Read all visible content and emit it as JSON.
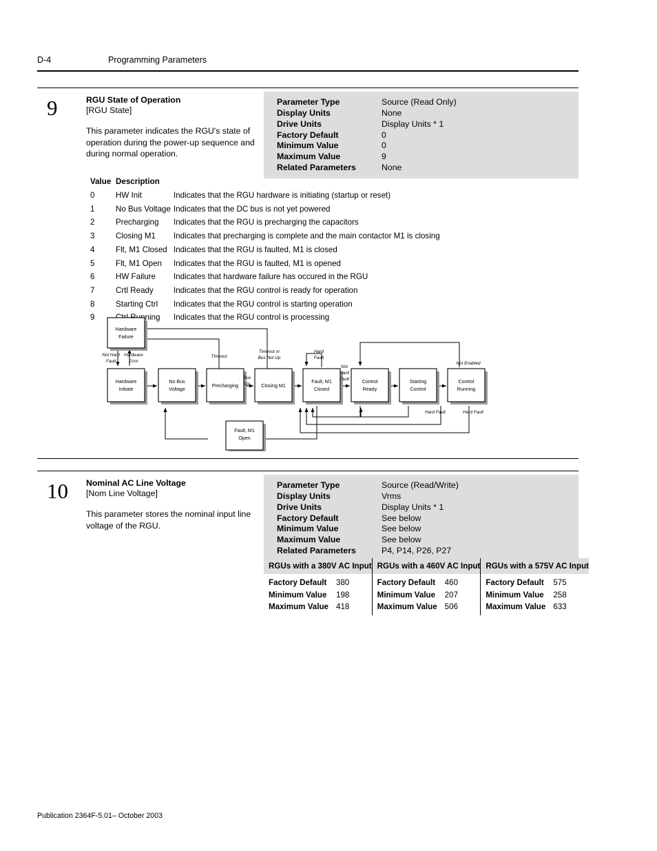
{
  "header": {
    "folio": "D-4",
    "title": "Programming Parameters"
  },
  "footer": {
    "publication": "Publication 2364F-5.01– October 2003"
  },
  "parameters": [
    {
      "number": "9",
      "title": "RGU State of Operation",
      "short_name": "[RGU State]",
      "description": "This parameter indicates the RGU's state of operation during the power-up sequence and during normal operation.",
      "spec": [
        {
          "key": "Parameter Type",
          "value": "Source (Read Only)"
        },
        {
          "key": "Display Units",
          "value": "None"
        },
        {
          "key": "Drive Units",
          "value": "Display Units * 1"
        },
        {
          "key": "Factory Default",
          "value": "0"
        },
        {
          "key": "Minimum Value",
          "value": "0"
        },
        {
          "key": "Maximum Value",
          "value": "9"
        },
        {
          "key": "Related Parameters",
          "value": "None"
        }
      ]
    },
    {
      "number": "10",
      "title": "Nominal AC Line Voltage",
      "short_name": "[Nom Line Voltage]",
      "description": "This parameter stores the nominal input line voltage of the RGU.",
      "spec": [
        {
          "key": "Parameter Type",
          "value": "Source (Read/Write)"
        },
        {
          "key": "Display Units",
          "value": "Vrms"
        },
        {
          "key": "Drive Units",
          "value": "Display Units * 1"
        },
        {
          "key": "Factory Default",
          "value": "See below"
        },
        {
          "key": "Minimum Value",
          "value": "See below"
        },
        {
          "key": "Maximum Value",
          "value": "See below"
        },
        {
          "key": "Related Parameters",
          "value": "P4, P14, P26, P27"
        }
      ]
    }
  ],
  "value_table": {
    "headers": [
      "Value",
      "Description",
      ""
    ],
    "rows": [
      {
        "value": "0",
        "name": "HW Init",
        "description": "Indicates that the RGU hardware is initiating (startup or reset)"
      },
      {
        "value": "1",
        "name": "No Bus Voltage",
        "description": "Indicates that the DC bus is not yet powered"
      },
      {
        "value": "2",
        "name": "Precharging",
        "description": "Indicates that the RGU is precharging the capacitors"
      },
      {
        "value": "3",
        "name": "Closing M1",
        "description": "Indicates that precharging is complete and the main contactor M1 is closing"
      },
      {
        "value": "4",
        "name": "Flt, M1 Closed",
        "description": "Indicates that the RGU is faulted, M1 is closed"
      },
      {
        "value": "5",
        "name": "Flt, M1 Open",
        "description": "Indicates that the RGU is faulted, M1 is opened"
      },
      {
        "value": "6",
        "name": "HW Failure",
        "description": "Indicates that hardware failure has occured in the RGU"
      },
      {
        "value": "7",
        "name": "Crtl Ready",
        "description": "Indicates that the RGU control is ready for operation"
      },
      {
        "value": "8",
        "name": "Starting Ctrl",
        "description": "Indicates that the RGU control is starting operation"
      },
      {
        "value": "9",
        "name": "Ctrl Running",
        "description": "Indicates that the RGU control is processing"
      }
    ]
  },
  "state_diagram": {
    "nodes": [
      {
        "id": "hw-failure",
        "label_line1": "Hardware",
        "label_line2": "Failure"
      },
      {
        "id": "hw-initiate",
        "label_line1": "Hardware",
        "label_line2": "Initiate"
      },
      {
        "id": "no-bus-voltage",
        "label_line1": "No Bus",
        "label_line2": "Voltage"
      },
      {
        "id": "precharging",
        "label_line1": "Precharging",
        "label_line2": ""
      },
      {
        "id": "closing-m1",
        "label_line1": "Closing M1",
        "label_line2": ""
      },
      {
        "id": "fault-m1-closed",
        "label_line1": "Fault, M1",
        "label_line2": "Closed"
      },
      {
        "id": "control-ready",
        "label_line1": "Control",
        "label_line2": "Ready"
      },
      {
        "id": "starting-control",
        "label_line1": "Starting",
        "label_line2": "Control"
      },
      {
        "id": "control-running",
        "label_line1": "Control",
        "label_line2": "Running"
      },
      {
        "id": "fault-m1-open",
        "label_line1": "Fault, M1",
        "label_line2": "Open"
      }
    ],
    "edge_labels": [
      {
        "id": "not-hard-fault-1",
        "line1": "Not Hard",
        "line2": "Fault"
      },
      {
        "id": "hardware-error",
        "line1": "Hardware",
        "line2": "Error"
      },
      {
        "id": "timeout",
        "line1": "Timeout",
        "line2": ""
      },
      {
        "id": "bus-up",
        "line1": "Bus",
        "line2": "Up"
      },
      {
        "id": "timeout-bus-not-up",
        "line1": "Timeout or",
        "line2": "Bus Not Up"
      },
      {
        "id": "hard-fault-1",
        "line1": "Hard",
        "line2": "Fault"
      },
      {
        "id": "not-hard-fault-2",
        "line1": "Not",
        "line2": "Hard",
        "line3": "Fault"
      },
      {
        "id": "not-enabled",
        "line1": "Not Enabled",
        "line2": ""
      },
      {
        "id": "hard-fault-2",
        "line1": "Hard Fault",
        "line2": ""
      },
      {
        "id": "hard-fault-3",
        "line1": "Hard Fault",
        "line2": ""
      }
    ]
  },
  "voltage_table": {
    "columns": [
      {
        "header": "RGUs with a 380V AC Input",
        "rows": [
          {
            "key": "Factory Default",
            "value": "380"
          },
          {
            "key": "Minimum Value",
            "value": "198"
          },
          {
            "key": "Maximum Value",
            "value": "418"
          }
        ]
      },
      {
        "header": "RGUs with a 460V AC Input",
        "rows": [
          {
            "key": "Factory Default",
            "value": "460"
          },
          {
            "key": "Minimum Value",
            "value": "207"
          },
          {
            "key": "Maximum Value",
            "value": "506"
          }
        ]
      },
      {
        "header": "RGUs with a 575V AC Input",
        "rows": [
          {
            "key": "Factory Default",
            "value": "575"
          },
          {
            "key": "Minimum Value",
            "value": "258"
          },
          {
            "key": "Maximum Value",
            "value": "633"
          }
        ]
      }
    ]
  }
}
